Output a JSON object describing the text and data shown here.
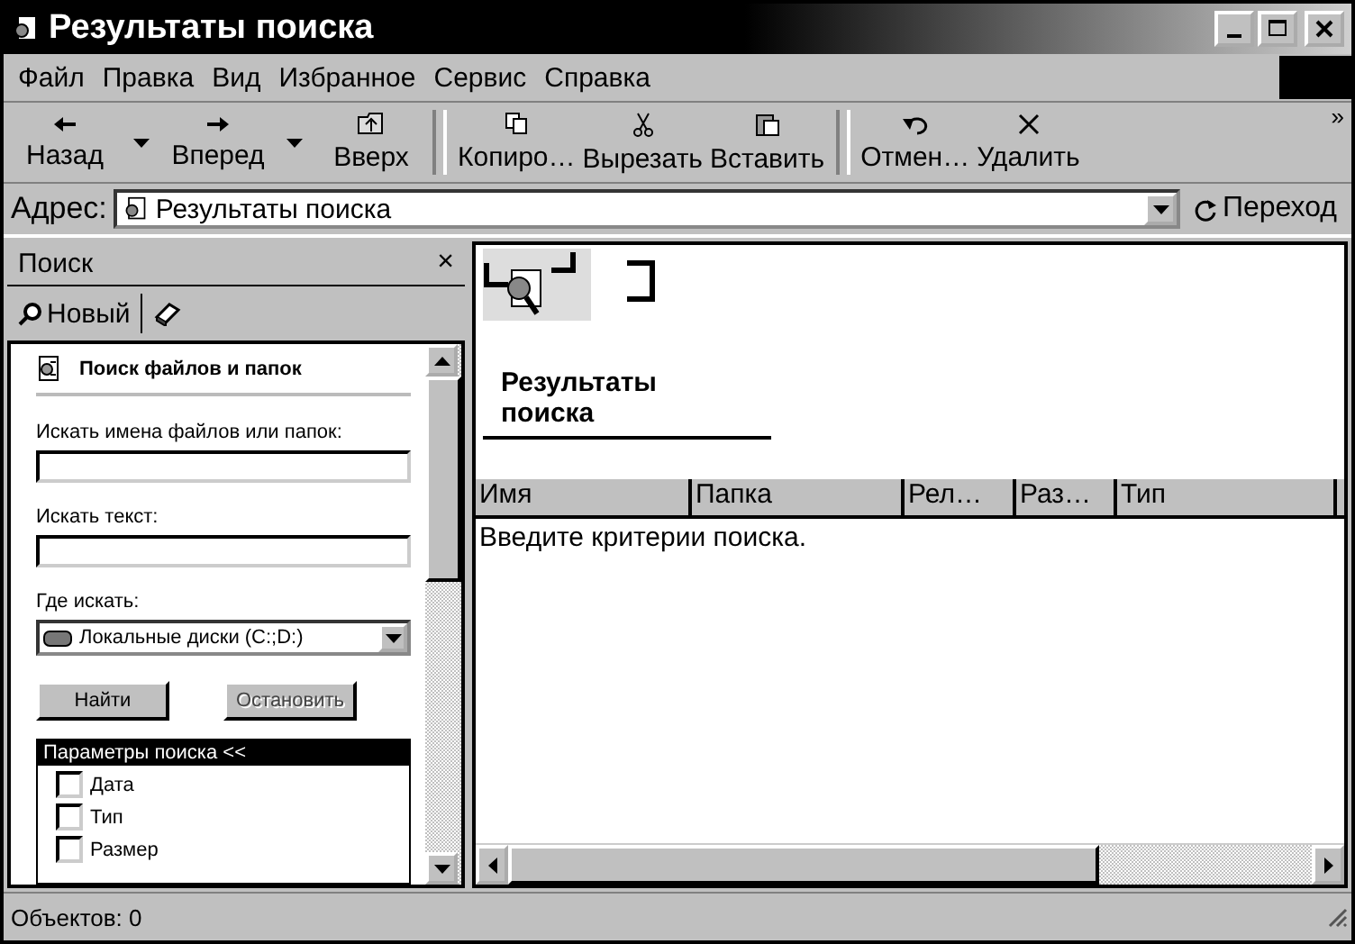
{
  "window": {
    "title": "Результаты поиска"
  },
  "menu": [
    "Файл",
    "Правка",
    "Вид",
    "Избранное",
    "Сервис",
    "Справка"
  ],
  "toolbar": [
    [
      {
        "label": "Назад",
        "kind": "back"
      },
      {
        "kind": "dropdown"
      },
      {
        "label": "Вперед",
        "kind": "forward"
      },
      {
        "kind": "dropdown"
      },
      {
        "label": "Вверх",
        "kind": "up"
      }
    ],
    [
      {
        "label": "Копиро…",
        "kind": "copy"
      },
      {
        "label": "Вырезать",
        "kind": "cut"
      },
      {
        "label": "Вставить",
        "kind": "paste"
      }
    ],
    [
      {
        "label": "Отмен…",
        "kind": "undo"
      },
      {
        "label": "Удалить",
        "kind": "delete"
      }
    ]
  ],
  "toolbar_overflow": "»",
  "address": {
    "label": "Адрес:",
    "value": "Результаты поиска",
    "go": "Переход"
  },
  "search_pane": {
    "title": "Поиск",
    "close": "×",
    "new_button": "Новый",
    "heading": "Поиск файлов и папок",
    "name_label": "Искать имена файлов или папок:",
    "text_label": "Искать текст:",
    "where_label": "Где искать:",
    "where_value": "Локальные диски (C:;D:)",
    "buttons": [
      {
        "label": "Найти",
        "disabled": false
      },
      {
        "label": "Остановить",
        "disabled": true
      }
    ],
    "options_title": "Параметры поиска  <<",
    "options": [
      {
        "label": "Дата",
        "checked": false
      },
      {
        "label": "Тип",
        "checked": false
      },
      {
        "label": "Размер",
        "checked": false
      }
    ]
  },
  "results": {
    "title": "Результаты поиска",
    "columns": [
      "Имя",
      "Папка",
      "Рел…",
      "Раз…",
      "Тип"
    ],
    "message": "Введите критерии поиска."
  },
  "status_bar": {
    "text": "Объектов: 0"
  }
}
